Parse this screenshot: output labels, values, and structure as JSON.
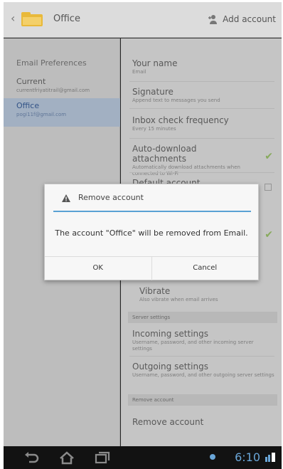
{
  "app": {
    "title": "Office",
    "add_account_label": "Add account"
  },
  "left_panel": {
    "heading": "Email Preferences",
    "accounts": [
      {
        "name": "Current",
        "email": "currentfriyatitrail@gmail.com",
        "selected": false
      },
      {
        "name": "Office",
        "email": "pogi11f@gmail.com",
        "selected": true
      }
    ]
  },
  "settings": {
    "your_name": {
      "title": "Your name",
      "subtitle": "Email"
    },
    "signature": {
      "title": "Signature",
      "subtitle": "Append text to messages you send"
    },
    "inbox_check": {
      "title": "Inbox check frequency",
      "subtitle": "Every 15 minutes"
    },
    "auto_download": {
      "title": "Auto-download attachments",
      "subtitle": "Automatically download attachments when connected to Wi-Fi",
      "checked": true
    },
    "default_account": {
      "title": "Default account"
    },
    "vibrate": {
      "title": "Vibrate",
      "subtitle": "Also vibrate when email arrives"
    },
    "server_section": "Server settings",
    "incoming": {
      "title": "Incoming settings",
      "subtitle": "Username, password, and other incoming server settings"
    },
    "outgoing": {
      "title": "Outgoing settings",
      "subtitle": "Username, password, and other outgoing server settings"
    },
    "remove_section": "Remove account",
    "remove_account": {
      "title": "Remove account"
    }
  },
  "dialog": {
    "title": "Remove account",
    "message": "The account \"Office\" will be removed from Email.",
    "ok_label": "OK",
    "cancel_label": "Cancel"
  },
  "system_bar": {
    "time": "6:10"
  },
  "colors": {
    "accent": "#5aa1d4",
    "check": "#9bc26a",
    "selected_row": "#b9c9dd"
  }
}
